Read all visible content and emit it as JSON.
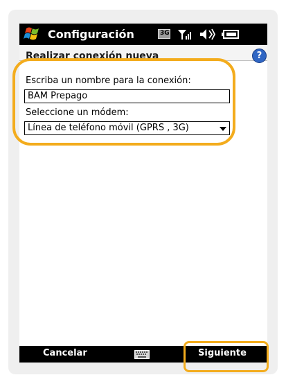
{
  "titlebar": {
    "title": "Configuración",
    "network_label": "3G"
  },
  "subheader": {
    "title": "Realizar conexión nueva",
    "help_label": "?"
  },
  "form": {
    "name_label": "Escriba un nombre para la conexión:",
    "name_value": "BAM Prepago",
    "modem_label": "Seleccione un módem:",
    "modem_value": "Línea de teléfono móvil (GPRS , 3G)"
  },
  "softkeys": {
    "left": "Cancelar",
    "right": "Siguiente"
  },
  "colors": {
    "highlight": "#f3ac1d",
    "titlebar_bg": "#000000",
    "help_bg": "#2f66c4"
  }
}
